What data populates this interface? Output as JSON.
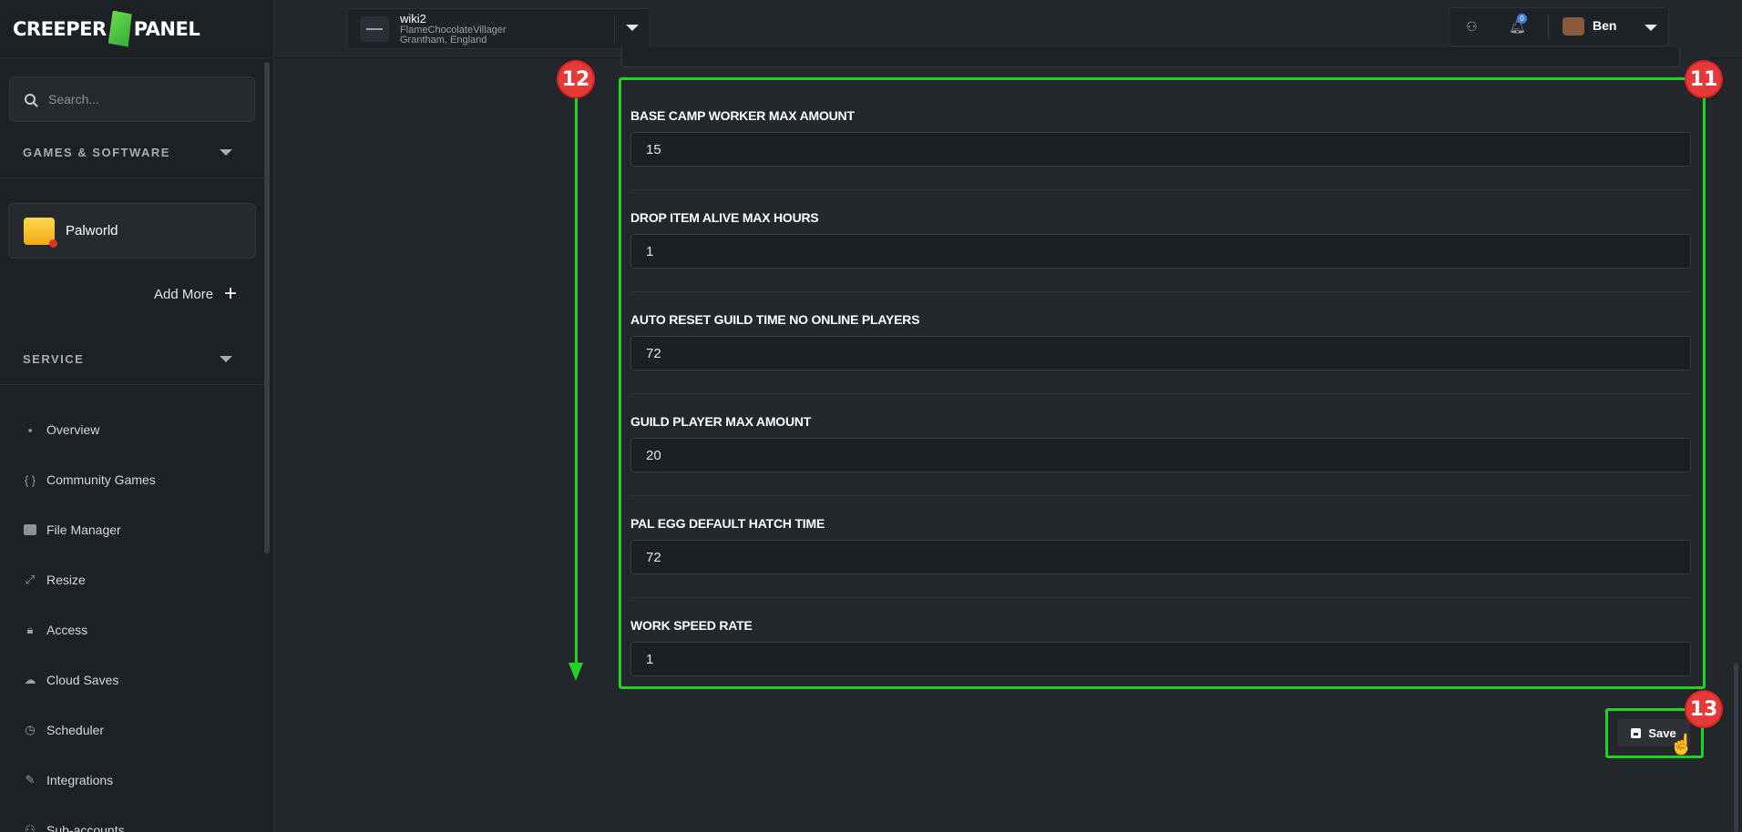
{
  "brand": {
    "logo_left": "CREEPER",
    "logo_right": "PANEL"
  },
  "search": {
    "placeholder": "Search..."
  },
  "sidebar": {
    "section_games": "GAMES & SOFTWARE",
    "game": "Palworld",
    "add_more": "Add More",
    "section_service": "SERVICE",
    "items": [
      {
        "label": "Overview",
        "icon": "grid-icon"
      },
      {
        "label": "Community Games",
        "icon": "braces-icon"
      },
      {
        "label": "File Manager",
        "icon": "folder-icon"
      },
      {
        "label": "Resize",
        "icon": "resize-icon"
      },
      {
        "label": "Access",
        "icon": "lock-icon"
      },
      {
        "label": "Cloud Saves",
        "icon": "cloud-icon"
      },
      {
        "label": "Scheduler",
        "icon": "clock-icon"
      },
      {
        "label": "Integrations",
        "icon": "wrench-icon"
      },
      {
        "label": "Sub-accounts",
        "icon": "users-icon"
      }
    ]
  },
  "server": {
    "name": "wiki2",
    "line1": "FlameChocolateVillager",
    "line2": "Grantham, England"
  },
  "user": {
    "name": "Ben",
    "notifications": "0"
  },
  "fields": [
    {
      "label": "BASE CAMP WORKER MAX AMOUNT",
      "value": "15"
    },
    {
      "label": "DROP ITEM ALIVE MAX HOURS",
      "value": "1"
    },
    {
      "label": "AUTO RESET GUILD TIME NO ONLINE PLAYERS",
      "value": "72"
    },
    {
      "label": "GUILD PLAYER MAX AMOUNT",
      "value": "20"
    },
    {
      "label": "PAL EGG DEFAULT HATCH TIME",
      "value": "72"
    },
    {
      "label": "WORK SPEED RATE",
      "value": "1"
    }
  ],
  "save_label": "Save",
  "annotations": {
    "b11": "11",
    "b12": "12",
    "b13": "13"
  },
  "colors": {
    "highlight": "#1fd41f",
    "badge": "#e43a3a"
  }
}
